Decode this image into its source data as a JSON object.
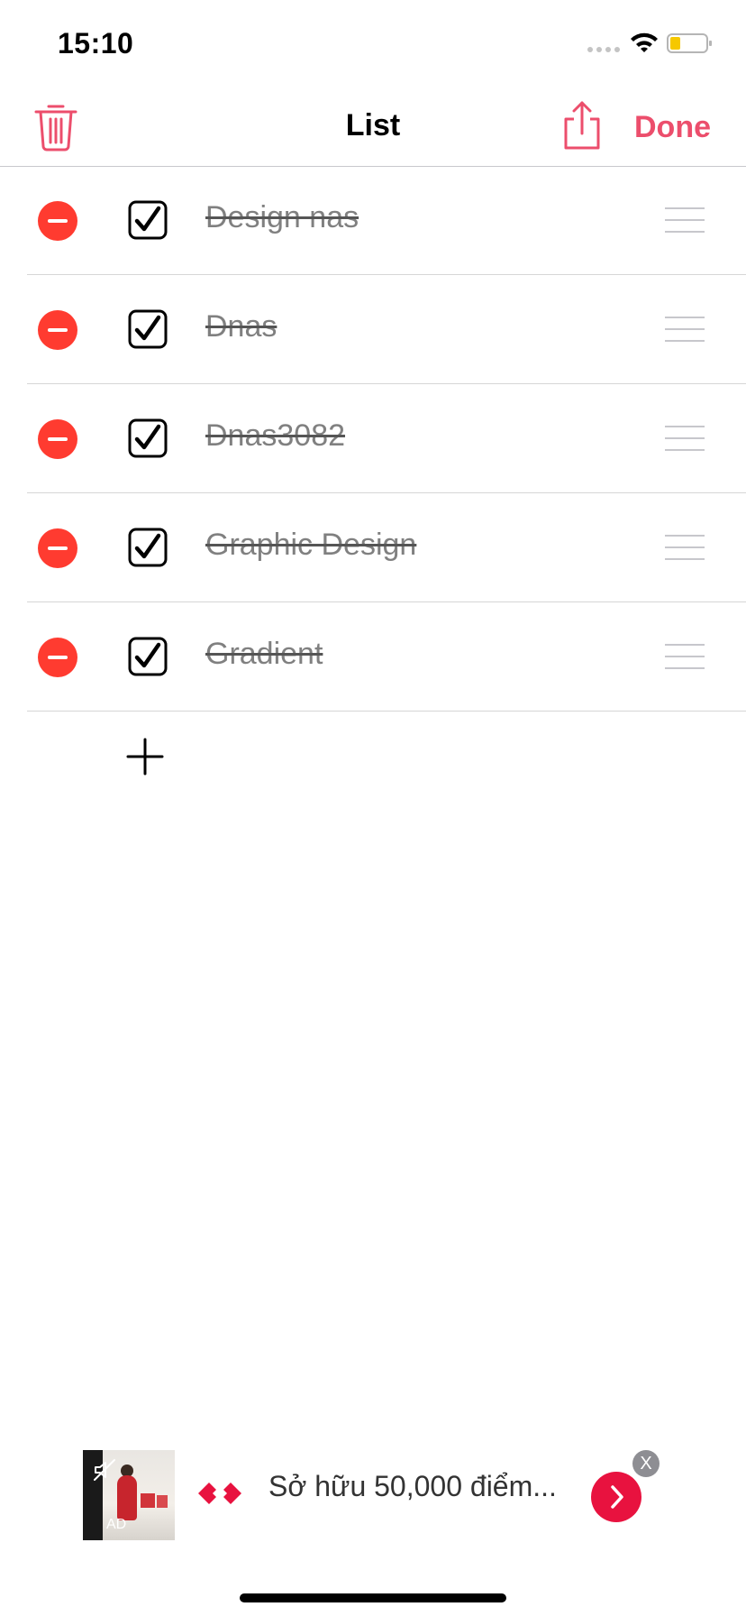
{
  "status_bar": {
    "time": "15:10"
  },
  "navbar": {
    "title": "List",
    "done_label": "Done"
  },
  "items": [
    {
      "label": "Design nas",
      "checked": true
    },
    {
      "label": "Dnas",
      "checked": true
    },
    {
      "label": "Dnas3082",
      "checked": true
    },
    {
      "label": "Graphic Design",
      "checked": true
    },
    {
      "label": "Gradient",
      "checked": true
    }
  ],
  "ad": {
    "badge": "AD",
    "text": "Sở hữu 50,000 điểm...",
    "close_label": "X"
  },
  "colors": {
    "accent": "#ec4e6c",
    "delete": "#ff3b30",
    "ad_button": "#e8123f"
  }
}
